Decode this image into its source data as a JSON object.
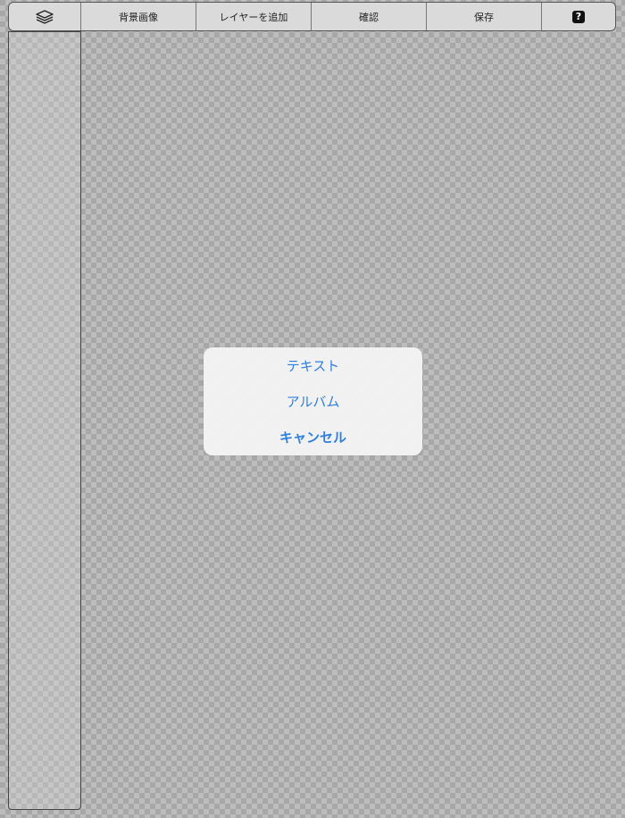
{
  "toolbar": {
    "layers_icon": "layers-icon",
    "background_image": "背景画像",
    "add_layer": "レイヤーを追加",
    "confirm": "確認",
    "save": "保存",
    "help": "?"
  },
  "action_sheet": {
    "text": "テキスト",
    "album": "アルバム",
    "cancel": "キャンセル"
  },
  "colors": {
    "accent": "#2f7fdc",
    "toolbar_bg": "#dadada"
  }
}
